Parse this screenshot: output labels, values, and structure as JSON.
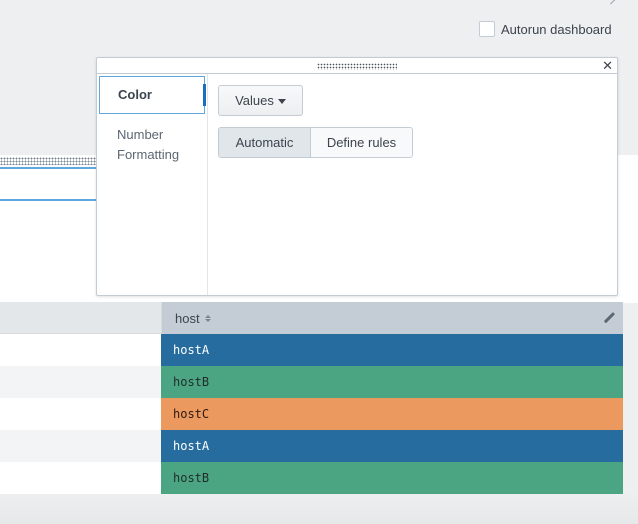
{
  "autorun": {
    "label": "Autorun dashboard",
    "checked": false
  },
  "popover": {
    "sidebar": [
      {
        "label": "Color",
        "active": true
      },
      {
        "label": "Number Formatting",
        "line1": "Number",
        "line2": "Formatting",
        "active": false
      }
    ],
    "values_button": "Values",
    "modes": [
      "Automatic",
      "Define rules"
    ],
    "selected_mode": "Automatic"
  },
  "table": {
    "column": "host",
    "rows": [
      {
        "host": "hostA",
        "color": "#266c9e",
        "text": "#ffffff"
      },
      {
        "host": "hostB",
        "color": "#4ca582",
        "text": "#1f2d28"
      },
      {
        "host": "hostC",
        "color": "#ec9960",
        "text": "#2b1a10"
      },
      {
        "host": "hostA",
        "color": "#266c9e",
        "text": "#ffffff"
      },
      {
        "host": "hostB",
        "color": "#4ca582",
        "text": "#1f2d28"
      }
    ]
  }
}
